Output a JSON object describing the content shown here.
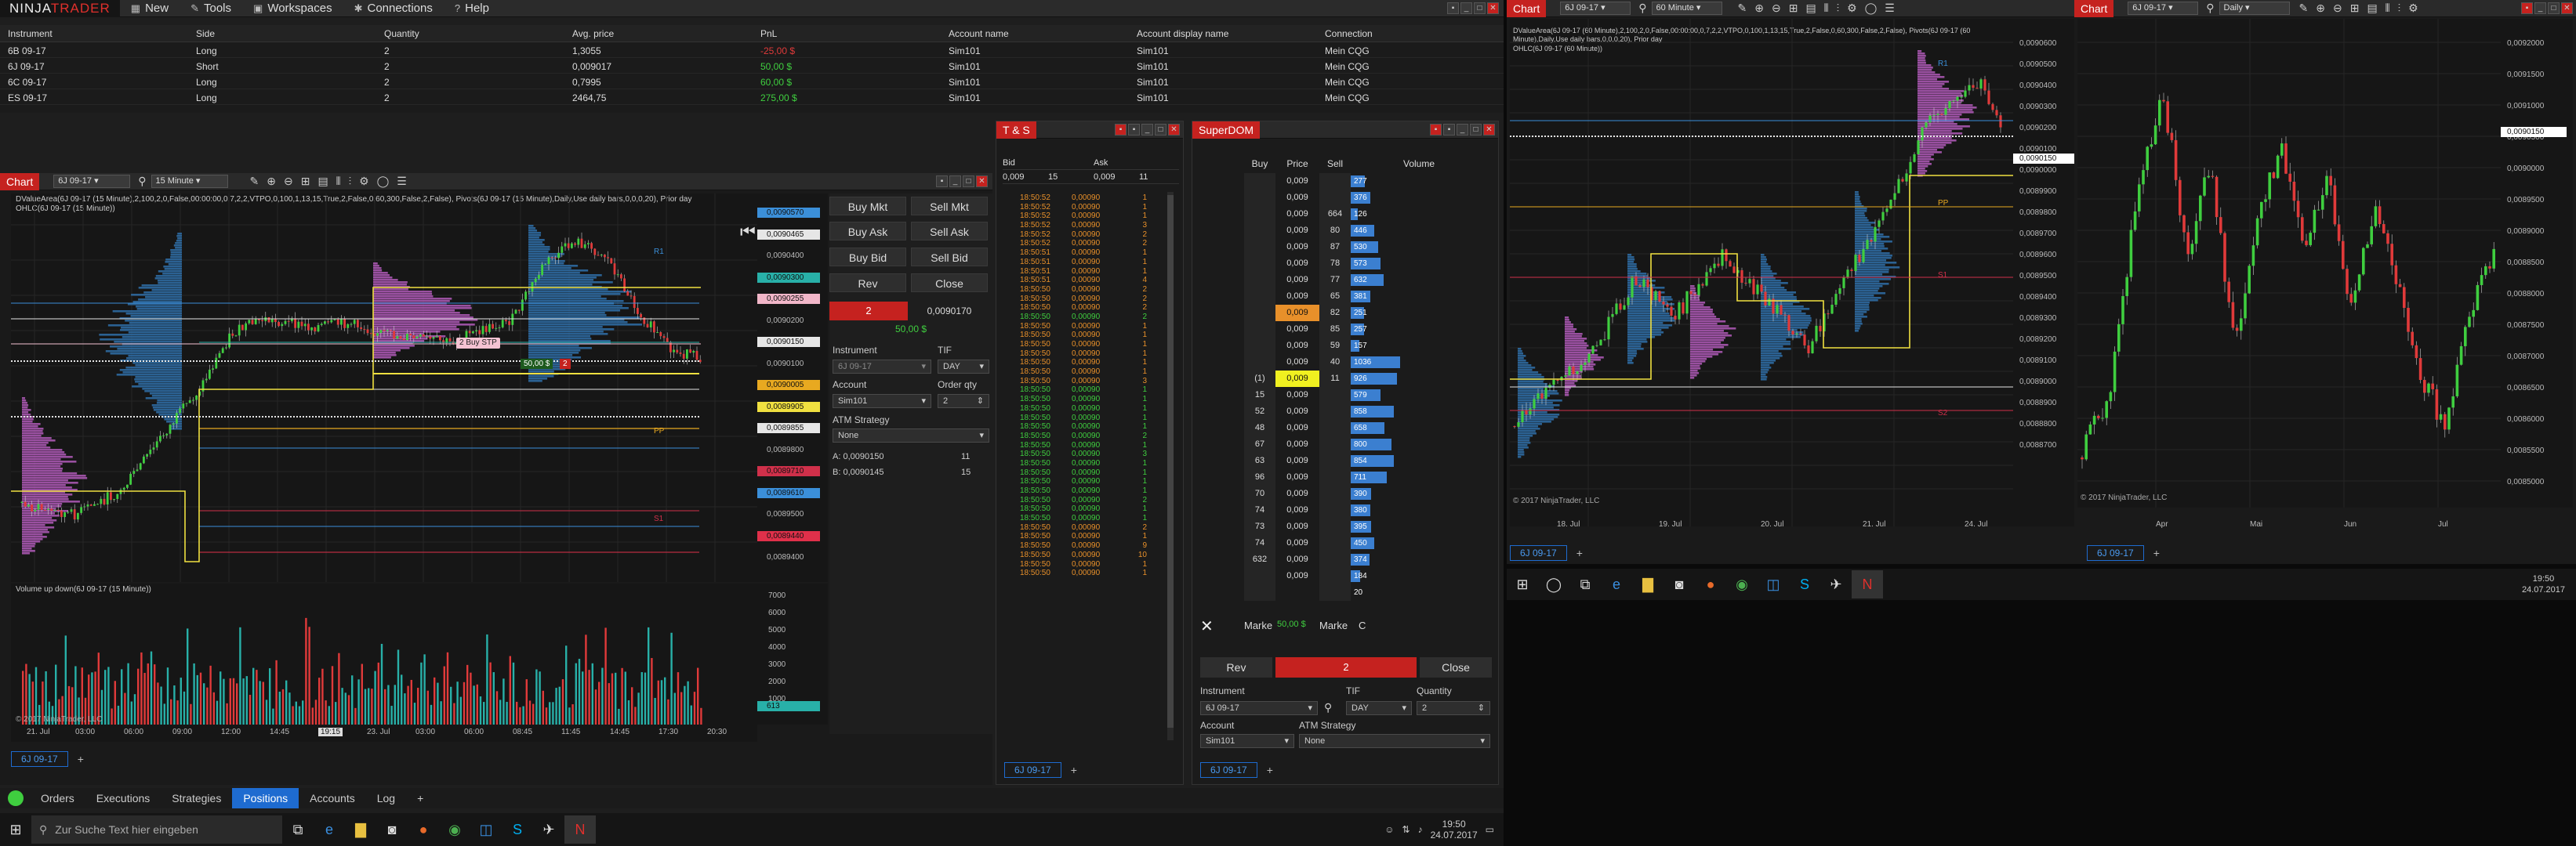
{
  "menu": {
    "logo_a": "NINJA",
    "logo_b": "TRADER",
    "items": [
      {
        "icon": "plus-icon",
        "label": "New"
      },
      {
        "icon": "tools-icon",
        "label": "Tools"
      },
      {
        "icon": "workspace-icon",
        "label": "Workspaces"
      },
      {
        "icon": "connection-icon",
        "label": "Connections"
      },
      {
        "icon": "help-icon",
        "label": "Help"
      }
    ]
  },
  "positions": {
    "headers": [
      "Instrument",
      "Side",
      "Quantity",
      "Avg. price",
      "PnL",
      "Account name",
      "Account display name",
      "Connection"
    ],
    "rows": [
      {
        "instrument": "6B 09-17",
        "side": "Long",
        "qty": "2",
        "avg": "1,3055",
        "pnl": "-25,00 $",
        "pnl_sign": "neg",
        "account": "Sim101",
        "display": "Sim101",
        "conn": "Mein CQG"
      },
      {
        "instrument": "6J 09-17",
        "side": "Short",
        "qty": "2",
        "avg": "0,009017",
        "pnl": "50,00 $",
        "pnl_sign": "pos",
        "account": "Sim101",
        "display": "Sim101",
        "conn": "Mein CQG"
      },
      {
        "instrument": "6C 09-17",
        "side": "Long",
        "qty": "2",
        "avg": "0,7995",
        "pnl": "60,00 $",
        "pnl_sign": "pos",
        "account": "Sim101",
        "display": "Sim101",
        "conn": "Mein CQG"
      },
      {
        "instrument": "ES 09-17",
        "side": "Long",
        "qty": "2",
        "avg": "2464,75",
        "pnl": "275,00 $",
        "pnl_sign": "pos",
        "account": "Sim101",
        "display": "Sim101",
        "conn": "Mein CQG"
      }
    ]
  },
  "chart1": {
    "title": "Chart",
    "instrument": "6J 09-17",
    "interval": "15 Minute",
    "indicator_line1": "DValueArea(6J 09-17 (15 Minute),2,100,2,0,False,00:00:00,0,7,2,2,VTPO,0,100,1,13,15,True,2,False,0,60,300,False,2,False), Pivots(6J 09-17 (15 Minute),Daily,Use daily bars,0,0,0,20), Prior day",
    "indicator_line2": "OHLC(6J 09-17 (15 Minute))",
    "price_labels": [
      {
        "v": "0,0090570",
        "c": "#3b8fd9"
      },
      {
        "v": "0,0090465",
        "c": "#e6e6e6"
      },
      {
        "v": "0,0090400",
        "c": "none"
      },
      {
        "v": "0,0090300",
        "c": "#28b0a8"
      },
      {
        "v": "0,0090255",
        "c": "#f1b6c8"
      },
      {
        "v": "0,0090200",
        "c": "none"
      },
      {
        "v": "0,0090150",
        "c": "#e6e6e6"
      },
      {
        "v": "0,0090100",
        "c": "none"
      },
      {
        "v": "0,0090005",
        "c": "#e8a920"
      },
      {
        "v": "0,0089905",
        "c": "#f0e040"
      },
      {
        "v": "0,0089855",
        "c": "#e6e6e6"
      },
      {
        "v": "0,0089800",
        "c": "none"
      },
      {
        "v": "0,0089710",
        "c": "#d0304a"
      },
      {
        "v": "0,0089610",
        "c": "#3b8fd9"
      },
      {
        "v": "0,0089500",
        "c": "none"
      },
      {
        "v": "0,0089440",
        "c": "#e0304a"
      },
      {
        "v": "0,0089400",
        "c": "none"
      }
    ],
    "x_ticks": [
      "21. Jul",
      "03:00",
      "06:00",
      "09:00",
      "12:00",
      "14:45",
      "19:15",
      "23. Jul",
      "03:00",
      "06:00",
      "08:45",
      "11:45",
      "14:45",
      "17:30",
      "20:30"
    ],
    "vol_title": "Volume up down(6J 09-17 (15 Minute))",
    "vol_ticks": [
      "7000",
      "6000",
      "5000",
      "4000",
      "3000",
      "2000",
      "1000"
    ],
    "vol_last": "613",
    "copyright": "© 2017 NinjaTrader, LLC",
    "order_buy_stp": "2  Buy STP",
    "order_pos": "50,00 $",
    "order_qty": "2",
    "pivot_r1": "R1",
    "pivot_pp": "PP",
    "pivot_s1": "S1",
    "tab": "6J 09-17"
  },
  "trader": {
    "buy_mkt": "Buy Mkt",
    "sell_mkt": "Sell Mkt",
    "buy_ask": "Buy Ask",
    "sell_ask": "Sell Ask",
    "buy_bid": "Buy Bid",
    "sell_bid": "Sell Bid",
    "rev": "Rev",
    "close": "Close",
    "pos_qty": "2",
    "pos_price": "0,0090170",
    "pos_pnl": "50,00 $",
    "instrument_lbl": "Instrument",
    "tif_lbl": "TIF",
    "instrument": "6J 09-17",
    "tif": "DAY",
    "account_lbl": "Account",
    "orderqty_lbl": "Order qty",
    "account": "Sim101",
    "orderqty": "2",
    "atm_lbl": "ATM Strategy",
    "atm": "None",
    "ask": "A:  0,0090150",
    "ask_sz": "11",
    "bid": "B:  0,0090145",
    "bid_sz": "15"
  },
  "ts": {
    "title": "T & S",
    "bid_h": "Bid",
    "ask_h": "Ask",
    "bid": "0,009",
    "bid_sz": "15",
    "ask": "0,009",
    "ask_sz": "11",
    "tab": "6J 09-17",
    "rows": [
      [
        "18:50:52",
        "0,00090",
        "1",
        "o"
      ],
      [
        "18:50:52",
        "0,00090",
        "1",
        "o"
      ],
      [
        "18:50:52",
        "0,00090",
        "1",
        "o"
      ],
      [
        "18:50:52",
        "0,00090",
        "3",
        "o"
      ],
      [
        "18:50:52",
        "0,00090",
        "2",
        "o"
      ],
      [
        "18:50:52",
        "0,00090",
        "2",
        "o"
      ],
      [
        "18:50:51",
        "0,00090",
        "1",
        "o"
      ],
      [
        "18:50:51",
        "0,00090",
        "1",
        "o"
      ],
      [
        "18:50:51",
        "0,00090",
        "1",
        "o"
      ],
      [
        "18:50:51",
        "0,00090",
        "4",
        "o"
      ],
      [
        "18:50:50",
        "0,00090",
        "2",
        "o"
      ],
      [
        "18:50:50",
        "0,00090",
        "2",
        "o"
      ],
      [
        "18:50:50",
        "0,00090",
        "2",
        "o"
      ],
      [
        "18:50:50",
        "0,00090",
        "2",
        "g"
      ],
      [
        "18:50:50",
        "0,00090",
        "1",
        "o"
      ],
      [
        "18:50:50",
        "0,00090",
        "1",
        "o"
      ],
      [
        "18:50:50",
        "0,00090",
        "1",
        "o"
      ],
      [
        "18:50:50",
        "0,00090",
        "1",
        "o"
      ],
      [
        "18:50:50",
        "0,00090",
        "1",
        "o"
      ],
      [
        "18:50:50",
        "0,00090",
        "1",
        "o"
      ],
      [
        "18:50:50",
        "0,00090",
        "3",
        "o"
      ],
      [
        "18:50:50",
        "0,00090",
        "1",
        "g"
      ],
      [
        "18:50:50",
        "0,00090",
        "1",
        "g"
      ],
      [
        "18:50:50",
        "0,00090",
        "1",
        "g"
      ],
      [
        "18:50:50",
        "0,00090",
        "1",
        "g"
      ],
      [
        "18:50:50",
        "0,00090",
        "1",
        "g"
      ],
      [
        "18:50:50",
        "0,00090",
        "2",
        "g"
      ],
      [
        "18:50:50",
        "0,00090",
        "1",
        "g"
      ],
      [
        "18:50:50",
        "0,00090",
        "3",
        "g"
      ],
      [
        "18:50:50",
        "0,00090",
        "1",
        "g"
      ],
      [
        "18:50:50",
        "0,00090",
        "1",
        "g"
      ],
      [
        "18:50:50",
        "0,00090",
        "1",
        "g"
      ],
      [
        "18:50:50",
        "0,00090",
        "1",
        "g"
      ],
      [
        "18:50:50",
        "0,00090",
        "2",
        "g"
      ],
      [
        "18:50:50",
        "0,00090",
        "1",
        "g"
      ],
      [
        "18:50:50",
        "0,00090",
        "1",
        "g"
      ],
      [
        "18:50:50",
        "0,00090",
        "2",
        "o"
      ],
      [
        "18:50:50",
        "0,00090",
        "1",
        "o"
      ],
      [
        "18:50:50",
        "0,00090",
        "9",
        "o"
      ],
      [
        "18:50:50",
        "0,00090",
        "10",
        "o"
      ],
      [
        "18:50:50",
        "0,00090",
        "1",
        "o"
      ],
      [
        "18:50:50",
        "0,00090",
        "1",
        "o"
      ]
    ]
  },
  "dom": {
    "title": "SuperDOM",
    "buy_h": "Buy",
    "price_h": "Price",
    "sell_h": "Sell",
    "vol_h": "Volume",
    "rows": [
      {
        "buy": "",
        "price": "0,009",
        "sell": "",
        "vol": "277",
        "vw": 0.28
      },
      {
        "buy": "",
        "price": "0,009",
        "sell": "",
        "vol": "376",
        "vw": 0.38
      },
      {
        "buy": "",
        "price": "0,009",
        "sell": "664",
        "vol": "126",
        "vw": 0.13
      },
      {
        "buy": "",
        "price": "0,009",
        "sell": "80",
        "vol": "446",
        "vw": 0.45
      },
      {
        "buy": "",
        "price": "0,009",
        "sell": "87",
        "vol": "530",
        "vw": 0.53
      },
      {
        "buy": "",
        "price": "0,009",
        "sell": "78",
        "vol": "573",
        "vw": 0.57
      },
      {
        "buy": "",
        "price": "0,009",
        "sell": "77",
        "vol": "632",
        "vw": 0.63
      },
      {
        "buy": "",
        "price": "0,009",
        "sell": "65",
        "vol": "381",
        "vw": 0.38
      },
      {
        "buy": "",
        "price": "0,009",
        "sell": "82",
        "vol": "251",
        "vw": 0.25,
        "hl": "orange"
      },
      {
        "buy": "",
        "price": "0,009",
        "sell": "85",
        "vol": "257",
        "vw": 0.26
      },
      {
        "buy": "",
        "price": "0,009",
        "sell": "59",
        "vol": "157",
        "vw": 0.16
      },
      {
        "buy": "",
        "price": "0,009",
        "sell": "40",
        "vol": "1036",
        "vw": 0.95
      },
      {
        "buy": "(1)",
        "price": "0,009",
        "sell": "11",
        "vol": "926",
        "vw": 0.9,
        "hl": "yellow"
      },
      {
        "buy": "15",
        "price": "0,009",
        "sell": "",
        "vol": "579",
        "vw": 0.58
      },
      {
        "buy": "52",
        "price": "0,009",
        "sell": "",
        "vol": "858",
        "vw": 0.84
      },
      {
        "buy": "48",
        "price": "0,009",
        "sell": "",
        "vol": "658",
        "vw": 0.65
      },
      {
        "buy": "67",
        "price": "0,009",
        "sell": "",
        "vol": "800",
        "vw": 0.79
      },
      {
        "buy": "63",
        "price": "0,009",
        "sell": "",
        "vol": "854",
        "vw": 0.84
      },
      {
        "buy": "96",
        "price": "0,009",
        "sell": "",
        "vol": "711",
        "vw": 0.7
      },
      {
        "buy": "70",
        "price": "0,009",
        "sell": "",
        "vol": "390",
        "vw": 0.39
      },
      {
        "buy": "74",
        "price": "0,009",
        "sell": "",
        "vol": "380",
        "vw": 0.38
      },
      {
        "buy": "73",
        "price": "0,009",
        "sell": "",
        "vol": "395",
        "vw": 0.39
      },
      {
        "buy": "74",
        "price": "0,009",
        "sell": "",
        "vol": "450",
        "vw": 0.45
      },
      {
        "buy": "632",
        "price": "0,009",
        "sell": "",
        "vol": "374",
        "vw": 0.37
      },
      {
        "buy": "",
        "price": "0,009",
        "sell": "",
        "vol": "184",
        "vw": 0.18
      },
      {
        "buy": "",
        "price": "",
        "sell": "",
        "vol": "20",
        "vw": 0
      }
    ],
    "marke1": "Marke",
    "pnl": "50,00 $",
    "marke2": "Marke",
    "c": "C",
    "rev": "Rev",
    "qty": "2",
    "close": "Close",
    "instrument_lbl": "Instrument",
    "tif_lbl": "TIF",
    "qty_lbl": "Quantity",
    "instrument": "6J 09-17",
    "tif": "DAY",
    "quantity": "2",
    "account_lbl": "Account",
    "atm_lbl": "ATM Strategy",
    "account": "Sim101",
    "atm": "None",
    "tab": "6J 09-17"
  },
  "chart2": {
    "title": "Chart",
    "instrument": "6J 09-17",
    "interval": "60 Minute",
    "indicator_line1": "DValueArea(6J 09-17 (60 Minute),2,100,2,0,False,00:00:00,0,7,2,2,VTPO,0,100,1,13,15,True,2,False,0,60,300,False,2,False), Pivots(6J 09-17 (60 Minute),Daily,Use daily bars,0,0,0,20), Prior day",
    "indicator_line2": "OHLC(6J 09-17 (60 Minute))",
    "y_ticks": [
      "0,0090600",
      "0,0090500",
      "0,0090400",
      "0,0090300",
      "0,0090200",
      "0,0090100",
      "0,0090000",
      "0,0089900",
      "0,0089800",
      "0,0089700",
      "0,0089600",
      "0,0089500",
      "0,0089400",
      "0,0089300",
      "0,0089200",
      "0,0089100",
      "0,0089000",
      "0,0088900",
      "0,0088800",
      "0,0088700"
    ],
    "last_price": "0,0090150",
    "x_ticks": [
      "18. Jul",
      "19. Jul",
      "20. Jul",
      "21. Jul",
      "24. Jul"
    ],
    "copyright": "© 2017 NinjaTrader, LLC",
    "tab": "6J 09-17",
    "pivot_r1": "R1",
    "pivot_pp": "PP",
    "pivot_s1": "S1",
    "pivot_s2": "S2"
  },
  "chart3": {
    "title": "Chart",
    "instrument": "6J 09-17",
    "interval": "Daily",
    "y_ticks": [
      "0,0092000",
      "0,0091500",
      "0,0091000",
      "0,0090500",
      "0,0090000",
      "0,0089500",
      "0,0089000",
      "0,0088500",
      "0,0088000",
      "0,0087500",
      "0,0087000",
      "0,0086500",
      "0,0086000",
      "0,0085500",
      "0,0085000"
    ],
    "last_price": "0,0090150",
    "x_ticks": [
      "Apr",
      "Mai",
      "Jun",
      "Jul"
    ],
    "copyright": "© 2017 NinjaTrader, LLC",
    "tab": "6J 09-17"
  },
  "bottom_tabs": {
    "items": [
      "Orders",
      "Executions",
      "Strategies",
      "Positions",
      "Accounts",
      "Log"
    ],
    "active": "Positions"
  },
  "taskbar": {
    "search": "Zur Suche Text hier eingeben",
    "time": "19:50",
    "date": "24.07.2017"
  }
}
